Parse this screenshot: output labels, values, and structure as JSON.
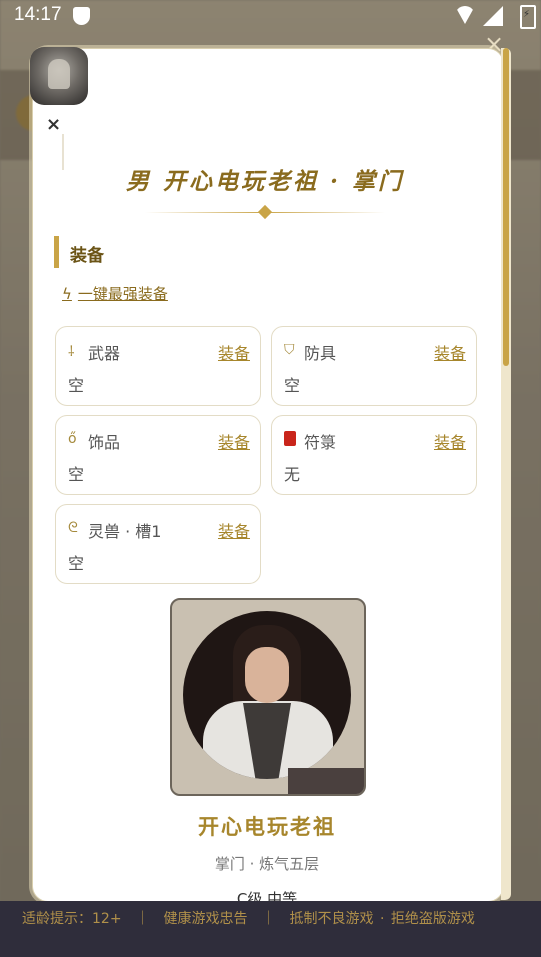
{
  "status_bar": {
    "time": "14:17"
  },
  "modal": {
    "title": "男 开心电玩老祖 · 掌门",
    "close_glyph": "×",
    "section_title": "装备",
    "best_equip_label": "一键最强装备",
    "slots": [
      {
        "icon": "sword-icon",
        "name": "武器",
        "equip": "装备",
        "value": "空"
      },
      {
        "icon": "shield-icon",
        "name": "防具",
        "equip": "装备",
        "value": "空"
      },
      {
        "icon": "ring-icon",
        "name": "饰品",
        "equip": "装备",
        "value": "空"
      },
      {
        "icon": "talisman-icon",
        "name": "符箓",
        "equip": "装备",
        "value": "无"
      },
      {
        "icon": "beast-icon",
        "name": "灵兽 · 槽1",
        "equip": "装备",
        "value": "空"
      }
    ],
    "character": {
      "name": "开心电玩老祖",
      "subtitle": "掌门 · 炼气五层",
      "grade": "C级 中等"
    }
  },
  "footer": {
    "text": "适龄提示：12+　｜　健康游戏忠告　｜　抵制不良游戏 · 拒绝盗版游戏"
  },
  "colors": {
    "accent": "#c9a447",
    "accent_text": "#a7862c",
    "footer_bg": "#2f2d3b"
  }
}
